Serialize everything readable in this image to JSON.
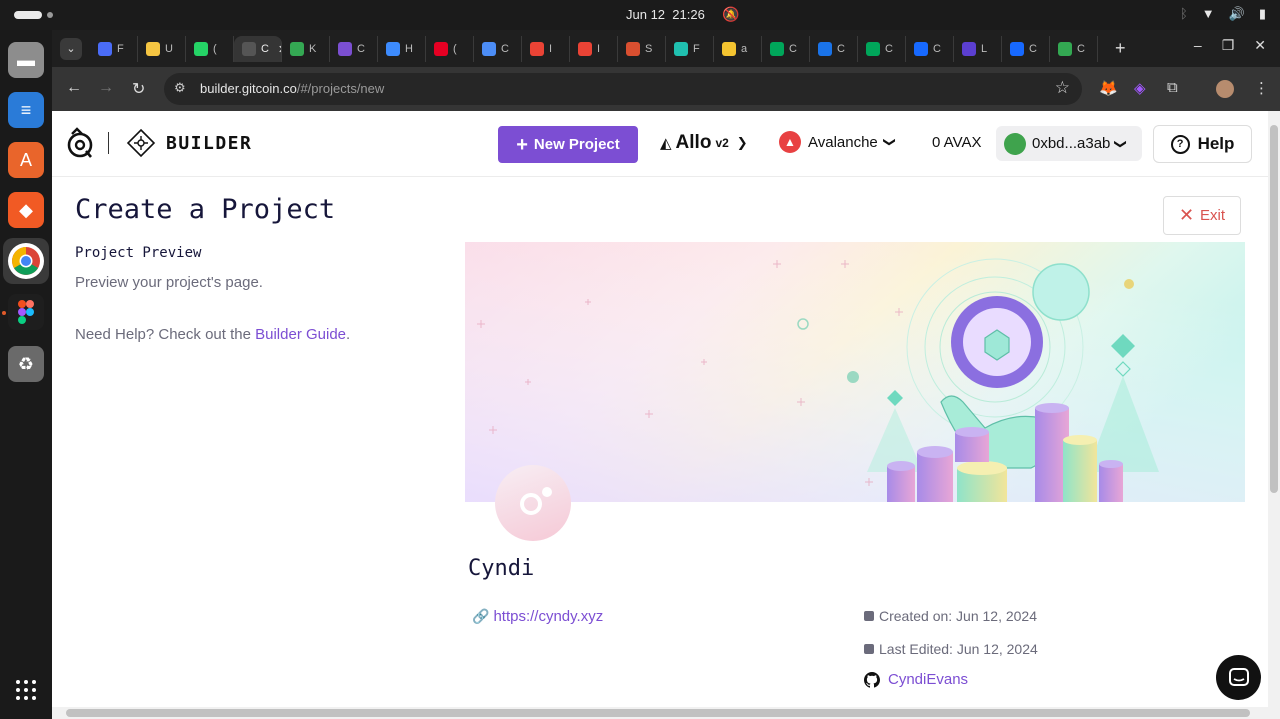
{
  "system": {
    "date": "Jun 12",
    "time": "21:26"
  },
  "browser": {
    "tabs": [
      {
        "label": "F",
        "color": "#4a6cf7"
      },
      {
        "label": "U",
        "color": "#f5c542"
      },
      {
        "label": "(",
        "color": "#25d366"
      },
      {
        "label": "C",
        "color": "#555555",
        "active": true
      },
      {
        "label": "K",
        "color": "#34a853"
      },
      {
        "label": "C",
        "color": "#7b4fd1"
      },
      {
        "label": "H",
        "color": "#3d8bfd"
      },
      {
        "label": "(",
        "color": "#e60023"
      },
      {
        "label": "C",
        "color": "#4c8df6"
      },
      {
        "label": "I",
        "color": "#ea4335"
      },
      {
        "label": "I",
        "color": "#ea4335"
      },
      {
        "label": "S",
        "color": "#d94f30"
      },
      {
        "label": "F",
        "color": "#20c0b0"
      },
      {
        "label": "a",
        "color": "#f4c430"
      },
      {
        "label": "C",
        "color": "#00a65a"
      },
      {
        "label": "C",
        "color": "#1a73e8"
      },
      {
        "label": "C",
        "color": "#00a65a"
      },
      {
        "label": "C",
        "color": "#1769ff"
      },
      {
        "label": "L",
        "color": "#5b3fd1"
      },
      {
        "label": "C",
        "color": "#1769ff"
      },
      {
        "label": "C",
        "color": "#33a852"
      }
    ],
    "url_host": "builder.gitcoin.co",
    "url_path": "/#/projects/new"
  },
  "app": {
    "brand": "BUILDER",
    "new_project": "New Project",
    "allo": "Allo",
    "allo_version": "v2",
    "network": "Avalanche",
    "balance": "0 AVAX",
    "wallet": "0xbd...a3ab",
    "help": "Help"
  },
  "page": {
    "title": "Create a Project",
    "exit": "Exit",
    "section_title": "Project Preview",
    "section_desc": "Preview your project's page.",
    "help_prefix": "Need Help? Check out the ",
    "help_link": "Builder Guide",
    "help_suffix": "."
  },
  "project": {
    "name": "Cyndi",
    "website": "https://cyndy.xyz",
    "created": "Created on: Jun 12, 2024",
    "edited": "Last Edited: Jun 12, 2024",
    "github": "CyndiEvans"
  },
  "colors": {
    "accent": "#7c4ed3",
    "exit": "#d9534f",
    "avalanche": "#e84142"
  }
}
